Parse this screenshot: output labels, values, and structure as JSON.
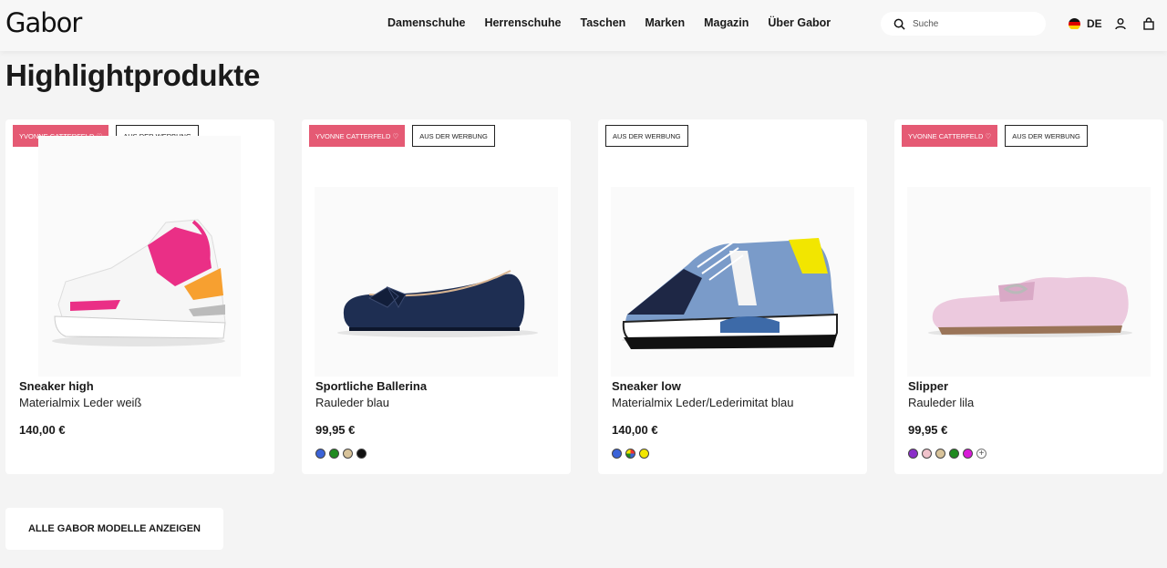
{
  "header": {
    "logo": "Gabor",
    "nav": [
      "Damenschuhe",
      "Herrenschuhe",
      "Taschen",
      "Marken",
      "Magazin",
      "Über Gabor"
    ],
    "search_placeholder": "Suche",
    "language": "DE"
  },
  "page_title": "Highlightprodukte",
  "products": [
    {
      "badges": [
        "YVONNE CATTERFELD ♡",
        "AUS DER WERBUNG"
      ],
      "name": "Sneaker high",
      "desc": "Materialmix Leder weiß",
      "price": "140,00 €",
      "swatches": []
    },
    {
      "badges": [
        "YVONNE CATTERFELD ♡",
        "AUS DER WERBUNG"
      ],
      "name": "Sportliche Ballerina",
      "desc": "Rauleder blau",
      "price": "99,95 €",
      "swatches": [
        "#3b63d8",
        "#1f8a1f",
        "#d8c39a",
        "#111111"
      ]
    },
    {
      "badges": [
        "AUS DER WERBUNG"
      ],
      "name": "Sneaker low",
      "desc": "Materialmix Leder/Lederimitat blau",
      "price": "140,00 €",
      "swatches": [
        "#3b63d8",
        "multi",
        "#f2e600"
      ]
    },
    {
      "badges": [
        "YVONNE CATTERFELD ♡",
        "AUS DER WERBUNG"
      ],
      "name": "Slipper",
      "desc": "Rauleder lila",
      "price": "99,95 €",
      "swatches": [
        "#8b2fc9",
        "#f0c2cb",
        "#d8c39a",
        "#1f8a1f",
        "#d81ad8"
      ],
      "more_swatches": true
    }
  ],
  "cta_label": "ALLE GABOR MODELLE ANZEIGEN",
  "colors": {
    "badge_pink": "#e55a74",
    "background": "#f4f4f4"
  }
}
